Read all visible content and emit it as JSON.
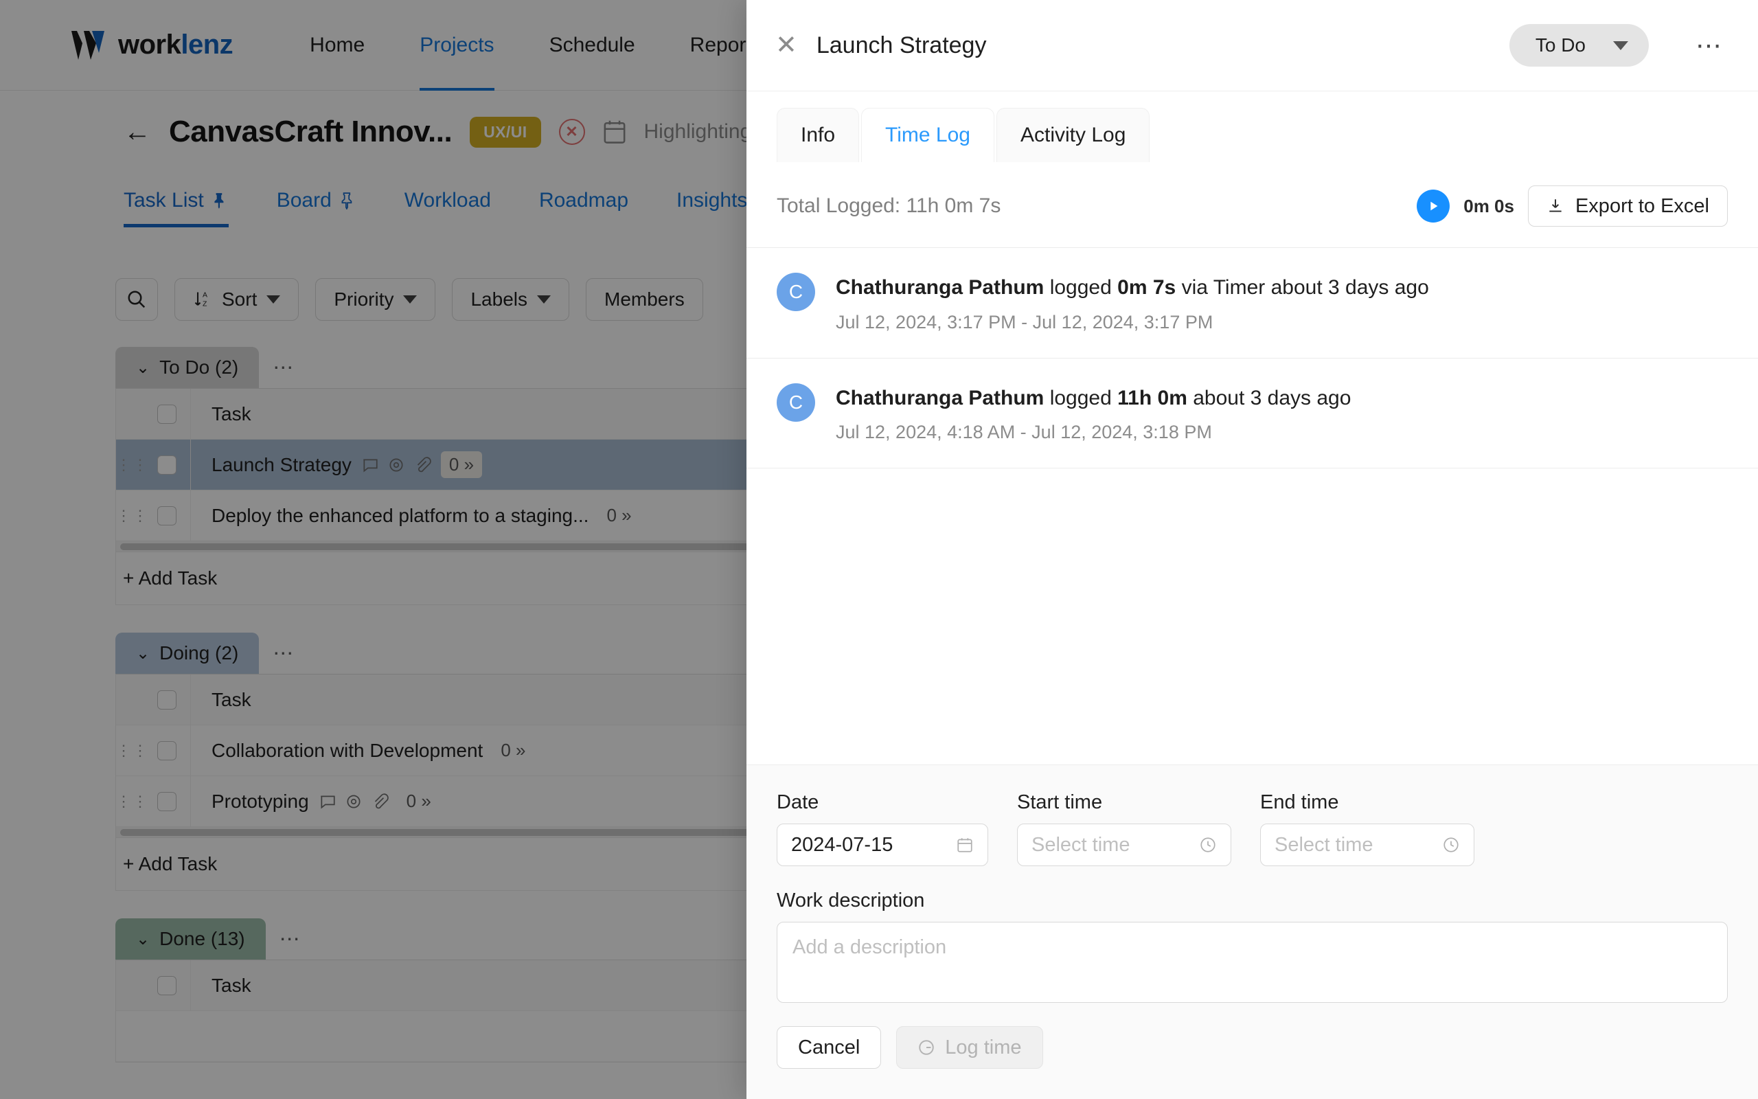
{
  "navbar": {
    "logo_dark": "work",
    "logo_blue": "lenz",
    "links": [
      {
        "label": "Home",
        "active": false
      },
      {
        "label": "Projects",
        "active": true
      },
      {
        "label": "Schedule",
        "active": false
      },
      {
        "label": "Reporting",
        "active": false
      }
    ]
  },
  "project": {
    "back_icon": "arrow-left-icon",
    "title": "CanvasCraft Innov...",
    "badge": "UX/UI",
    "status_icon": "x-circle-icon",
    "calendar_icon": "calendar-icon",
    "highlight_label": "Highlighting",
    "tabs": [
      {
        "label": "Task List",
        "active": true,
        "pin": "pin-filled-icon"
      },
      {
        "label": "Board",
        "active": false,
        "pin": "pin-outline-icon"
      },
      {
        "label": "Workload",
        "active": false,
        "pin": ""
      },
      {
        "label": "Roadmap",
        "active": false,
        "pin": ""
      },
      {
        "label": "Insights",
        "active": false,
        "pin": ""
      }
    ],
    "filters": [
      {
        "label": "",
        "icon": "search-icon",
        "caret": false
      },
      {
        "label": "Sort",
        "icon": "sort-az-icon",
        "caret": true
      },
      {
        "label": "Priority",
        "icon": "",
        "caret": true
      },
      {
        "label": "Labels",
        "icon": "",
        "caret": true
      },
      {
        "label": "Members",
        "icon": "",
        "caret": false
      }
    ],
    "add_task_label": "+ Add Task",
    "column_header": "Task",
    "groups": [
      {
        "name": "To Do (2)",
        "color_class": "todo",
        "rows": [
          {
            "title": "Launch Strategy",
            "selected": true,
            "icons": [
              "comment-icon",
              "eye-icon",
              "paperclip-icon"
            ],
            "sub": "0",
            "sub_boxed": true
          },
          {
            "title": "Deploy the enhanced platform to a staging...",
            "selected": false,
            "icons": [],
            "sub": "0",
            "sub_boxed": false
          }
        ]
      },
      {
        "name": "Doing (2)",
        "color_class": "doing",
        "rows": [
          {
            "title": "Collaboration with Development",
            "selected": false,
            "icons": [],
            "sub": "0",
            "sub_boxed": false
          },
          {
            "title": "Prototyping",
            "selected": false,
            "icons": [
              "comment-icon",
              "eye-icon",
              "paperclip-icon"
            ],
            "sub": "0",
            "sub_boxed": false
          }
        ]
      },
      {
        "name": "Done (13)",
        "color_class": "done",
        "rows": []
      }
    ]
  },
  "drawer": {
    "close_icon": "close-icon",
    "title": "Launch Strategy",
    "status": "To Do",
    "more_icon": "ellipsis-icon",
    "tabs": [
      {
        "label": "Info",
        "active": false
      },
      {
        "label": "Time Log",
        "active": true
      },
      {
        "label": "Activity Log",
        "active": false
      }
    ],
    "total_logged": "Total Logged: 11h 0m 7s",
    "timer_icon": "play-icon",
    "timer_value": "0m 0s",
    "export_icon": "download-icon",
    "export_label": "Export to Excel",
    "entries": [
      {
        "avatar": "C",
        "user": "Chathuranga Pathum",
        "verb": "logged",
        "duration": "0m 7s",
        "suffix": "via Timer about 3 days ago",
        "range": "Jul 12, 2024, 3:17 PM - Jul 12, 2024, 3:17 PM"
      },
      {
        "avatar": "C",
        "user": "Chathuranga Pathum",
        "verb": "logged",
        "duration": "11h 0m",
        "suffix": "about 3 days ago",
        "range": "Jul 12, 2024, 4:18 AM - Jul 12, 2024, 3:18 PM"
      }
    ],
    "form": {
      "date_label": "Date",
      "date_value": "2024-07-15",
      "date_icon": "calendar-icon",
      "start_label": "Start time",
      "start_placeholder": "Select time",
      "start_icon": "clock-icon",
      "end_label": "End time",
      "end_placeholder": "Select time",
      "end_icon": "clock-icon",
      "desc_label": "Work description",
      "desc_placeholder": "Add a description",
      "cancel_label": "Cancel",
      "log_icon": "timer-icon",
      "log_label": "Log time"
    }
  },
  "colors": {
    "accent_blue": "#1677d9",
    "tab_active_blue": "#2b9afc",
    "play_blue": "#1890ff",
    "badge_gold": "#d4af24",
    "group_todo": "#d9d9d9",
    "group_doing": "#b7c8de",
    "group_done": "#9dbdab",
    "row_selected": "#a9bdd4"
  }
}
